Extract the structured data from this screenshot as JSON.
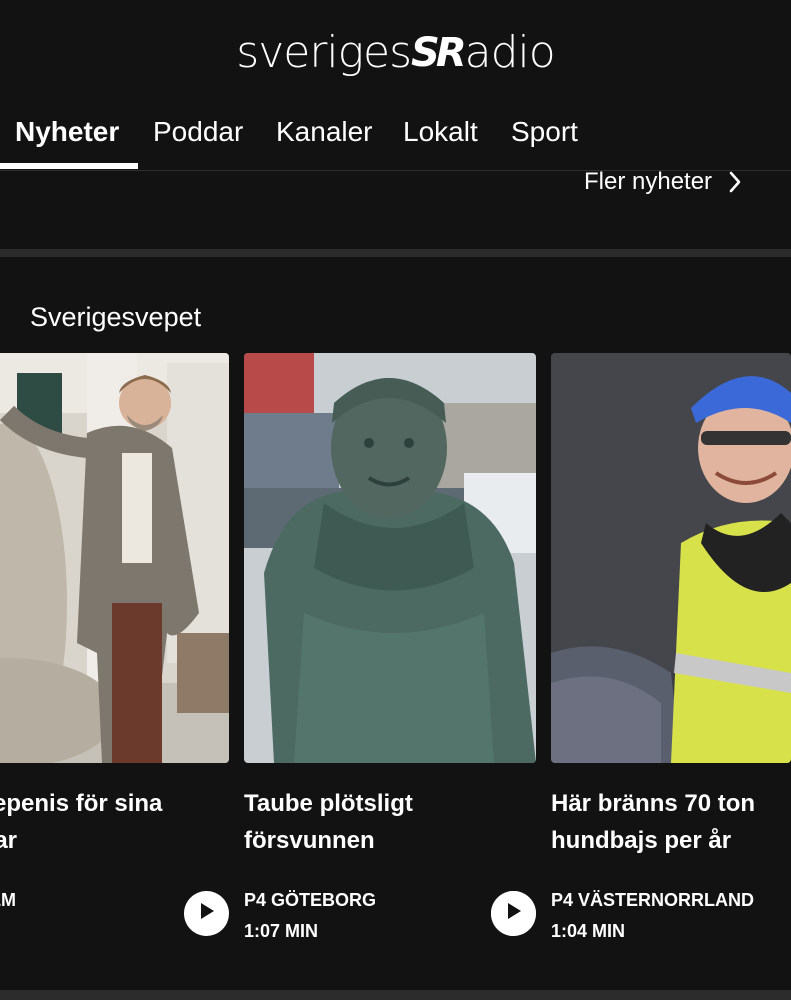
{
  "logo": {
    "left_text": "sveriges",
    "mark": "SR",
    "right_text": "adio"
  },
  "nav": {
    "tabs": [
      {
        "label": "Nyheter",
        "active": true
      },
      {
        "label": "Poddar",
        "active": false
      },
      {
        "label": "Kanaler",
        "active": false
      },
      {
        "label": "Lokalt",
        "active": false
      },
      {
        "label": "Sport",
        "active": false
      }
    ]
  },
  "more_news": {
    "label": "Fler nyheter",
    "icon": "chevron-right-icon"
  },
  "section": {
    "title": "Sverigesvepet"
  },
  "cards": [
    {
      "title_line1": "e jättepenis för sina",
      "title_line2": "pengar",
      "channel": "CKHOLM",
      "duration": "N",
      "play_icon": "play-icon"
    },
    {
      "title_line1": "Taube plötsligt",
      "title_line2": "försvunnen",
      "channel": "P4 GÖTEBORG",
      "duration": "1:07 MIN",
      "play_icon": "play-icon"
    },
    {
      "title_line1": "Här bränns 70 ton",
      "title_line2": "hundbajs per år",
      "channel": "P4 VÄSTERNORRLAND",
      "duration": "1:04 MIN",
      "play_icon": "play-icon"
    }
  ],
  "colors": {
    "background": "#121212",
    "text": "#ffffff",
    "divider": "#2c2c2c"
  }
}
